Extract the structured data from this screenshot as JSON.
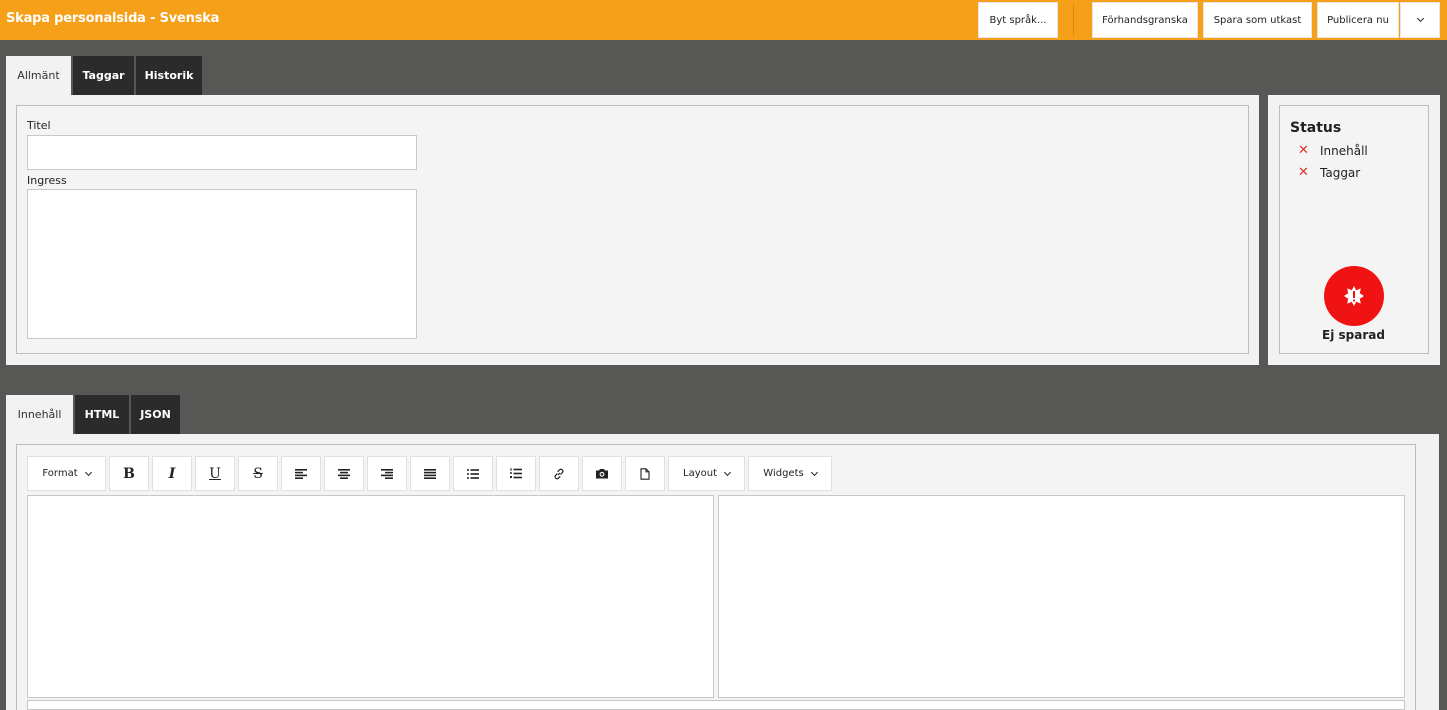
{
  "header": {
    "title": "Skapa personalsida - Svenska",
    "change_language": "Byt språk...",
    "preview": "Förhandsgranska",
    "save_draft": "Spara som utkast",
    "publish_now": "Publicera nu",
    "accent_color": "#f6a01a"
  },
  "top_tabs": [
    {
      "label": "Allmänt",
      "active": true
    },
    {
      "label": "Taggar",
      "active": false
    },
    {
      "label": "Historik",
      "active": false
    }
  ],
  "general": {
    "title_label": "Titel",
    "title_value": "",
    "ingress_label": "Ingress",
    "ingress_value": ""
  },
  "status": {
    "heading": "Status",
    "items": [
      {
        "label": "Innehåll",
        "icon": "x-icon"
      },
      {
        "label": "Taggar",
        "icon": "x-icon"
      }
    ],
    "badge_label": "Ej sparad",
    "badge_color": "#f01313"
  },
  "content_tabs": [
    {
      "label": "Innehåll",
      "active": true
    },
    {
      "label": "HTML",
      "active": false
    },
    {
      "label": "JSON",
      "active": false
    }
  ],
  "toolbar": {
    "format_label": "Format",
    "bold_label": "B",
    "italic_label": "I",
    "underline_label": "U",
    "strike_label": "S",
    "layout_label": "Layout",
    "widgets_label": "Widgets"
  }
}
